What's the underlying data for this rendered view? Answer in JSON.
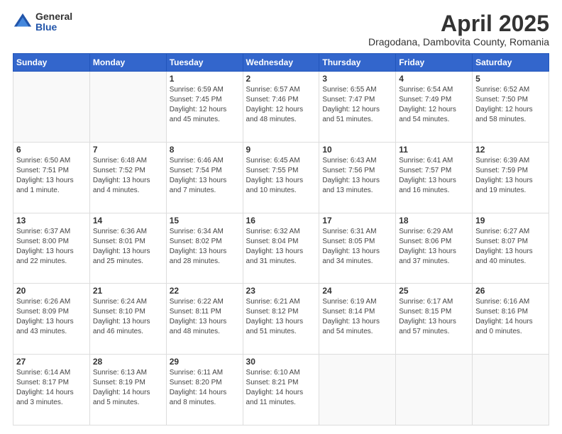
{
  "logo": {
    "general": "General",
    "blue": "Blue"
  },
  "header": {
    "month": "April 2025",
    "location": "Dragodana, Dambovita County, Romania"
  },
  "weekdays": [
    "Sunday",
    "Monday",
    "Tuesday",
    "Wednesday",
    "Thursday",
    "Friday",
    "Saturday"
  ],
  "weeks": [
    [
      {
        "day": "",
        "sunrise": "",
        "sunset": "",
        "daylight": ""
      },
      {
        "day": "",
        "sunrise": "",
        "sunset": "",
        "daylight": ""
      },
      {
        "day": "1",
        "sunrise": "Sunrise: 6:59 AM",
        "sunset": "Sunset: 7:45 PM",
        "daylight": "Daylight: 12 hours and 45 minutes."
      },
      {
        "day": "2",
        "sunrise": "Sunrise: 6:57 AM",
        "sunset": "Sunset: 7:46 PM",
        "daylight": "Daylight: 12 hours and 48 minutes."
      },
      {
        "day": "3",
        "sunrise": "Sunrise: 6:55 AM",
        "sunset": "Sunset: 7:47 PM",
        "daylight": "Daylight: 12 hours and 51 minutes."
      },
      {
        "day": "4",
        "sunrise": "Sunrise: 6:54 AM",
        "sunset": "Sunset: 7:49 PM",
        "daylight": "Daylight: 12 hours and 54 minutes."
      },
      {
        "day": "5",
        "sunrise": "Sunrise: 6:52 AM",
        "sunset": "Sunset: 7:50 PM",
        "daylight": "Daylight: 12 hours and 58 minutes."
      }
    ],
    [
      {
        "day": "6",
        "sunrise": "Sunrise: 6:50 AM",
        "sunset": "Sunset: 7:51 PM",
        "daylight": "Daylight: 13 hours and 1 minute."
      },
      {
        "day": "7",
        "sunrise": "Sunrise: 6:48 AM",
        "sunset": "Sunset: 7:52 PM",
        "daylight": "Daylight: 13 hours and 4 minutes."
      },
      {
        "day": "8",
        "sunrise": "Sunrise: 6:46 AM",
        "sunset": "Sunset: 7:54 PM",
        "daylight": "Daylight: 13 hours and 7 minutes."
      },
      {
        "day": "9",
        "sunrise": "Sunrise: 6:45 AM",
        "sunset": "Sunset: 7:55 PM",
        "daylight": "Daylight: 13 hours and 10 minutes."
      },
      {
        "day": "10",
        "sunrise": "Sunrise: 6:43 AM",
        "sunset": "Sunset: 7:56 PM",
        "daylight": "Daylight: 13 hours and 13 minutes."
      },
      {
        "day": "11",
        "sunrise": "Sunrise: 6:41 AM",
        "sunset": "Sunset: 7:57 PM",
        "daylight": "Daylight: 13 hours and 16 minutes."
      },
      {
        "day": "12",
        "sunrise": "Sunrise: 6:39 AM",
        "sunset": "Sunset: 7:59 PM",
        "daylight": "Daylight: 13 hours and 19 minutes."
      }
    ],
    [
      {
        "day": "13",
        "sunrise": "Sunrise: 6:37 AM",
        "sunset": "Sunset: 8:00 PM",
        "daylight": "Daylight: 13 hours and 22 minutes."
      },
      {
        "day": "14",
        "sunrise": "Sunrise: 6:36 AM",
        "sunset": "Sunset: 8:01 PM",
        "daylight": "Daylight: 13 hours and 25 minutes."
      },
      {
        "day": "15",
        "sunrise": "Sunrise: 6:34 AM",
        "sunset": "Sunset: 8:02 PM",
        "daylight": "Daylight: 13 hours and 28 minutes."
      },
      {
        "day": "16",
        "sunrise": "Sunrise: 6:32 AM",
        "sunset": "Sunset: 8:04 PM",
        "daylight": "Daylight: 13 hours and 31 minutes."
      },
      {
        "day": "17",
        "sunrise": "Sunrise: 6:31 AM",
        "sunset": "Sunset: 8:05 PM",
        "daylight": "Daylight: 13 hours and 34 minutes."
      },
      {
        "day": "18",
        "sunrise": "Sunrise: 6:29 AM",
        "sunset": "Sunset: 8:06 PM",
        "daylight": "Daylight: 13 hours and 37 minutes."
      },
      {
        "day": "19",
        "sunrise": "Sunrise: 6:27 AM",
        "sunset": "Sunset: 8:07 PM",
        "daylight": "Daylight: 13 hours and 40 minutes."
      }
    ],
    [
      {
        "day": "20",
        "sunrise": "Sunrise: 6:26 AM",
        "sunset": "Sunset: 8:09 PM",
        "daylight": "Daylight: 13 hours and 43 minutes."
      },
      {
        "day": "21",
        "sunrise": "Sunrise: 6:24 AM",
        "sunset": "Sunset: 8:10 PM",
        "daylight": "Daylight: 13 hours and 46 minutes."
      },
      {
        "day": "22",
        "sunrise": "Sunrise: 6:22 AM",
        "sunset": "Sunset: 8:11 PM",
        "daylight": "Daylight: 13 hours and 48 minutes."
      },
      {
        "day": "23",
        "sunrise": "Sunrise: 6:21 AM",
        "sunset": "Sunset: 8:12 PM",
        "daylight": "Daylight: 13 hours and 51 minutes."
      },
      {
        "day": "24",
        "sunrise": "Sunrise: 6:19 AM",
        "sunset": "Sunset: 8:14 PM",
        "daylight": "Daylight: 13 hours and 54 minutes."
      },
      {
        "day": "25",
        "sunrise": "Sunrise: 6:17 AM",
        "sunset": "Sunset: 8:15 PM",
        "daylight": "Daylight: 13 hours and 57 minutes."
      },
      {
        "day": "26",
        "sunrise": "Sunrise: 6:16 AM",
        "sunset": "Sunset: 8:16 PM",
        "daylight": "Daylight: 14 hours and 0 minutes."
      }
    ],
    [
      {
        "day": "27",
        "sunrise": "Sunrise: 6:14 AM",
        "sunset": "Sunset: 8:17 PM",
        "daylight": "Daylight: 14 hours and 3 minutes."
      },
      {
        "day": "28",
        "sunrise": "Sunrise: 6:13 AM",
        "sunset": "Sunset: 8:19 PM",
        "daylight": "Daylight: 14 hours and 5 minutes."
      },
      {
        "day": "29",
        "sunrise": "Sunrise: 6:11 AM",
        "sunset": "Sunset: 8:20 PM",
        "daylight": "Daylight: 14 hours and 8 minutes."
      },
      {
        "day": "30",
        "sunrise": "Sunrise: 6:10 AM",
        "sunset": "Sunset: 8:21 PM",
        "daylight": "Daylight: 14 hours and 11 minutes."
      },
      {
        "day": "",
        "sunrise": "",
        "sunset": "",
        "daylight": ""
      },
      {
        "day": "",
        "sunrise": "",
        "sunset": "",
        "daylight": ""
      },
      {
        "day": "",
        "sunrise": "",
        "sunset": "",
        "daylight": ""
      }
    ]
  ]
}
